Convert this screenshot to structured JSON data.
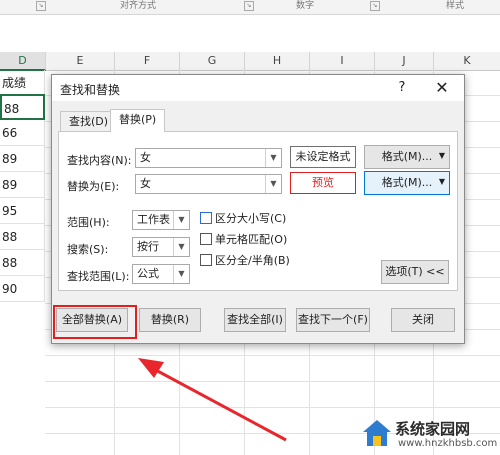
{
  "ribbon": {
    "groups": [
      "对齐方式",
      "数字",
      "样式"
    ]
  },
  "sheet": {
    "columns": [
      "D",
      "E",
      "F",
      "G",
      "H",
      "I",
      "J",
      "K"
    ],
    "col_d_values": [
      "成绩",
      "88",
      "66",
      "89",
      "89",
      "95",
      "88",
      "88",
      "90"
    ]
  },
  "dialog": {
    "title": "查找和替换",
    "help": "?",
    "close": "✕",
    "tabs": [
      "查找(D)",
      "替换(P)"
    ],
    "find_label": "查找内容(N):",
    "find_value": "女",
    "replace_label": "替换为(E):",
    "replace_value": "女",
    "format_not_set": "未设定格式",
    "format_preview": "预览",
    "format_button": "格式(M)...",
    "within_label": "范围(H):",
    "within_value": "工作表",
    "search_label": "搜索(S):",
    "search_value": "按行",
    "lookin_label": "查找范围(L):",
    "lookin_value": "公式",
    "match_case": "区分大小写(C)",
    "match_entire": "单元格匹配(O)",
    "match_width": "区分全/半角(B)",
    "options_button": "选项(T) <<",
    "replace_all": "全部替换(A)",
    "replace": "替换(R)",
    "find_all": "查找全部(I)",
    "find_next": "查找下一个(F)",
    "close_button": "关闭"
  },
  "watermark": {
    "text": "系统家园网",
    "url": "www.hnzkhbsb.com"
  }
}
